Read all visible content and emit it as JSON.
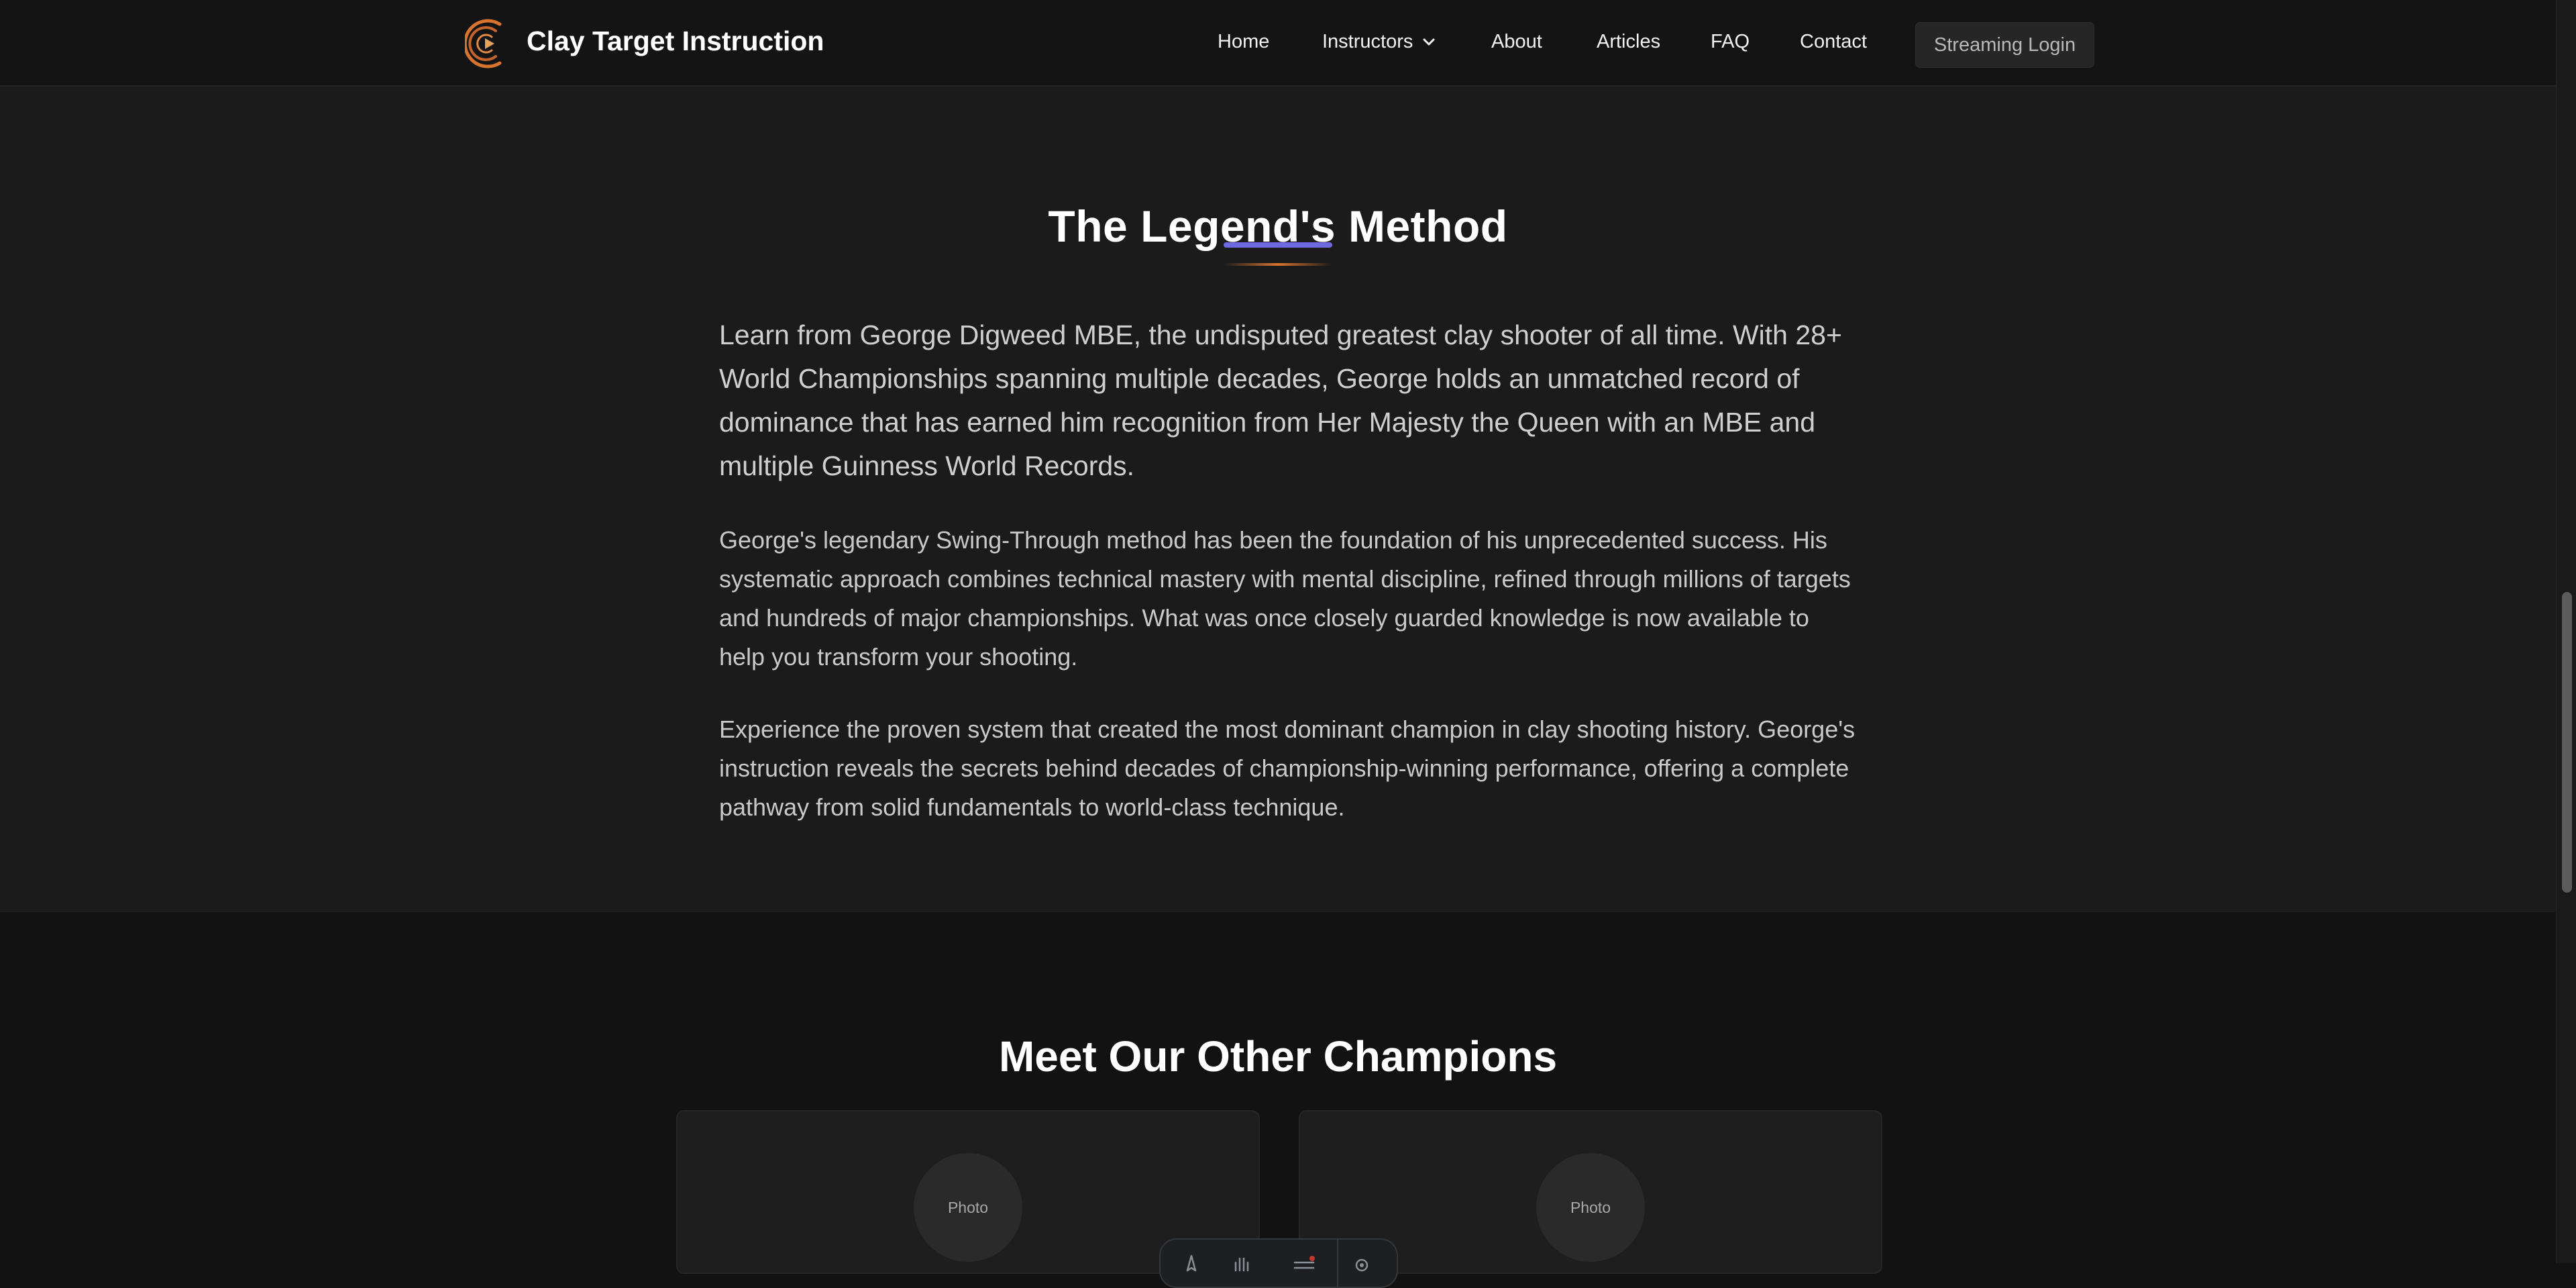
{
  "header": {
    "brand": "Clay Target Instruction",
    "nav": {
      "home": "Home",
      "instructors": "Instructors",
      "about": "About",
      "articles": "Articles",
      "faq": "FAQ",
      "contact": "Contact"
    },
    "login_label": "Streaming Login",
    "logo_icon": "clay-target-logo-icon",
    "accent_orange": "#d8742e"
  },
  "method": {
    "title": "The Legend's Method",
    "divider_colors": [
      "#6f68e0",
      "#d8742e"
    ],
    "lead": "Learn from George Digweed MBE, the undisputed greatest clay shooter of all time. With 28+ World Championships spanning multiple decades, George holds an unmatched record of dominance that has earned him recognition from Her Majesty the Queen with an MBE and multiple Guinness World Records.",
    "paragraph2": "George's legendary Swing-Through method has been the foundation of his unprecedented success. His systematic approach combines technical mastery with mental discipline, refined through millions of targets and hundreds of major championships. What was once closely guarded knowledge is now available to help you transform your shooting.",
    "paragraph3": "Experience the proven system that created the most dominant champion in clay shooting history. George's instruction reveals the secrets behind decades of championship-winning performance, offering a complete pathway from solid fundamentals to world-class technique."
  },
  "champions": {
    "title": "Meet Our Other Champions",
    "cards": [
      {
        "photo_label": "Photo"
      },
      {
        "photo_label": "Photo"
      }
    ]
  },
  "toolbar": {
    "icons": [
      "inspect-icon",
      "hand-icon",
      "layers-icon",
      "settings-icon"
    ]
  }
}
